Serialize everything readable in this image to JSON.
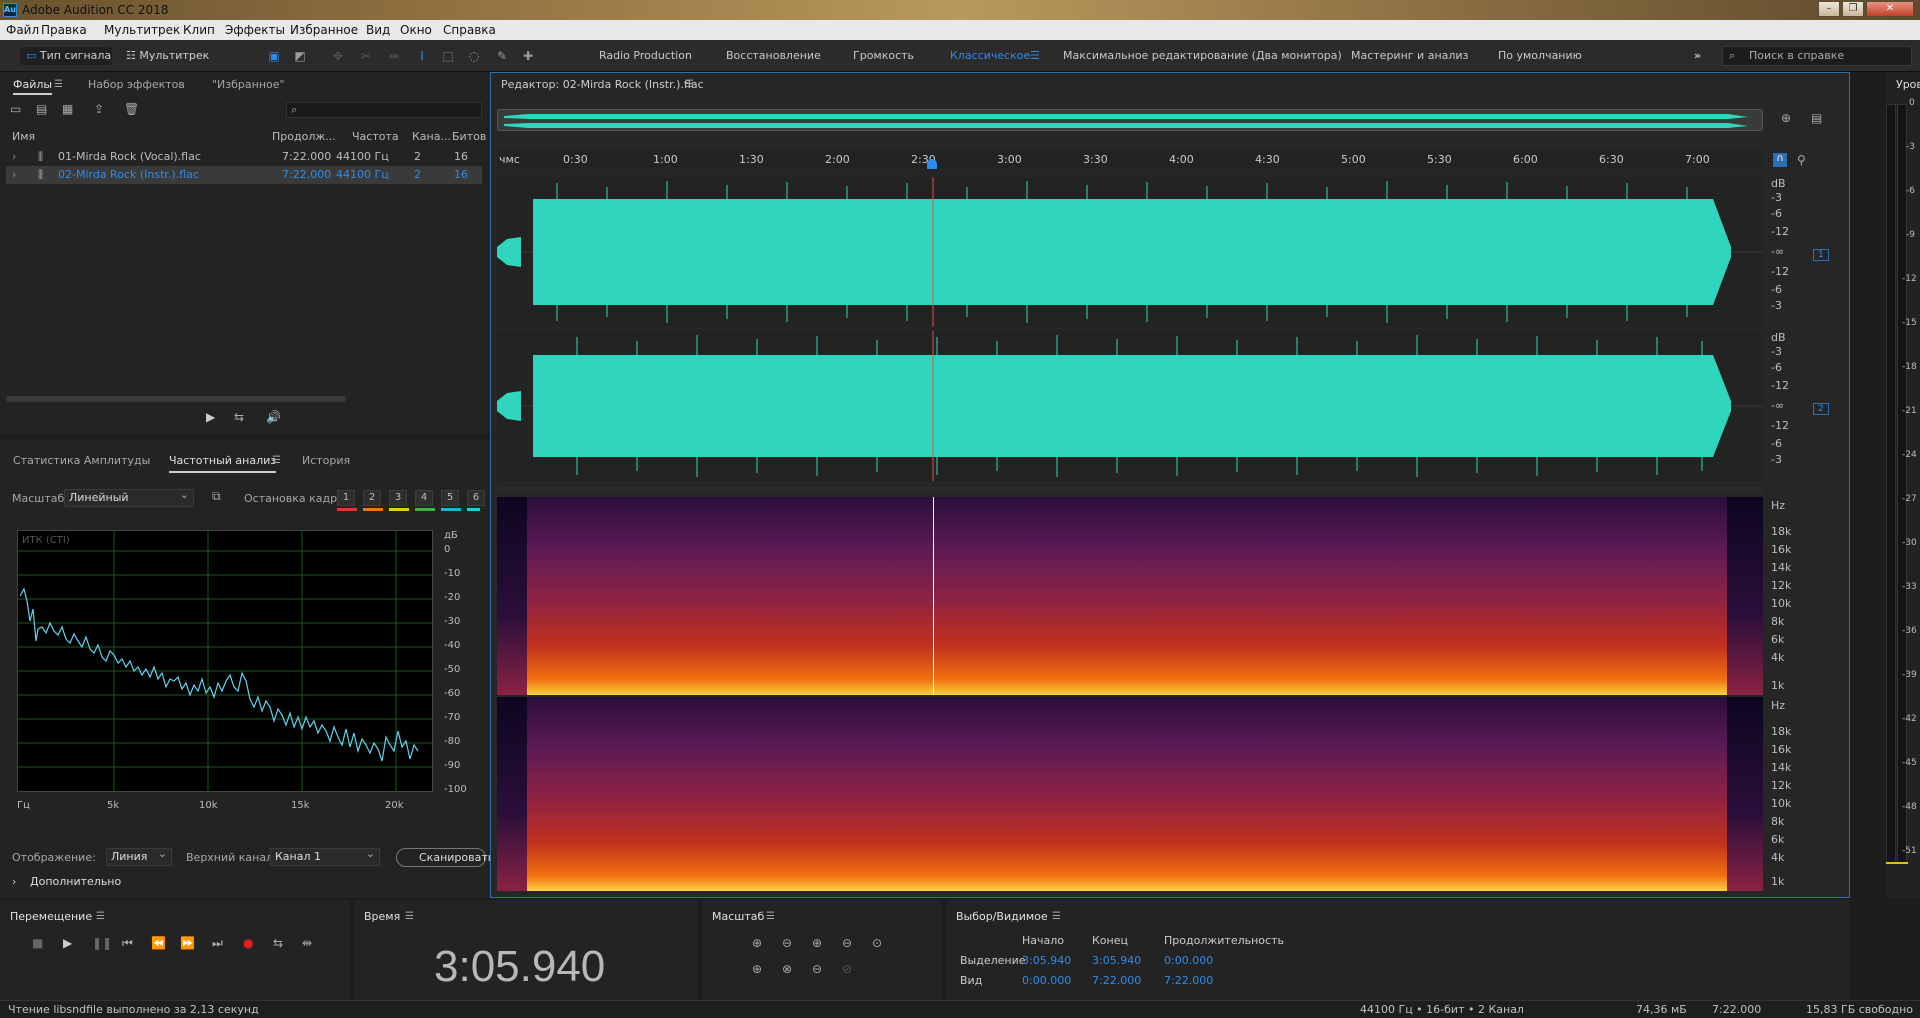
{
  "titlebar": {
    "title": "Adobe Audition CC 2018",
    "app_icon": "Au"
  },
  "menu": [
    "Файл",
    "Правка",
    "Мультитрек",
    "Клип",
    "Эффекты",
    "Избранное",
    "Вид",
    "Окно",
    "Справка"
  ],
  "toolbar": {
    "waveform": "Тип сигнала",
    "multitrack": "Мультитрек",
    "workspaces": [
      "Radio Production",
      "Восстановление",
      "Громкость",
      "Классическое",
      "Максимальное редактирование (Два монитора)",
      "Мастеринг и анализ",
      "По умолчанию"
    ],
    "active_workspace": "Классическое",
    "search_placeholder": "Поиск в справке"
  },
  "files_panel": {
    "tabs": [
      "Файлы",
      "Набор эффектов",
      "\"Избранное\""
    ],
    "columns": [
      "Имя",
      "Продолж...",
      "Частота",
      "Кана...",
      "Битов"
    ],
    "rows": [
      {
        "name": "01-Mirda Rock (Vocal).flac",
        "duration": "7:22.000",
        "rate": "44100 Гц",
        "channels": "2",
        "bits": "16",
        "selected": false
      },
      {
        "name": "02-Mirda Rock (Instr.).flac",
        "duration": "7:22.000",
        "rate": "44100 Гц",
        "channels": "2",
        "bits": "16",
        "selected": true
      }
    ]
  },
  "analysis_panel": {
    "tabs": [
      "Статистика Амплитуды",
      "Частотный анализ",
      "История"
    ],
    "scale_label": "Масштаб:",
    "scale_value": "Линейный",
    "freeze_label": "Остановка кадра:",
    "freeze_slots": [
      "1",
      "2",
      "3",
      "4",
      "5",
      "6"
    ],
    "slot_colors": [
      "#e03a2a",
      "#e07a1a",
      "#e0d01a",
      "#3ab43a",
      "#1ab4d0",
      "#1ad0e0"
    ],
    "plot_label": "ИТК (СТI)",
    "db_ticks": [
      "дБ",
      "0",
      "-10",
      "-20",
      "-30",
      "-40",
      "-50",
      "-60",
      "-70",
      "-80",
      "-90",
      "-100"
    ],
    "freq_ticks": [
      "Гц",
      "5k",
      "10k",
      "15k",
      "20k"
    ],
    "display_label": "Отображение:",
    "display_value": "Линия",
    "channel_label": "Верхний канал:",
    "channel_value": "Канал 1",
    "scan_button": "Сканировать",
    "advanced": "Дополнительно"
  },
  "editor": {
    "title": "Редактор: 02-Mirda Rock (Instr.).flac",
    "ruler": [
      "чмс",
      "0:30",
      "1:00",
      "1:30",
      "2:00",
      "2:30",
      "3:00",
      "3:30",
      "4:00",
      "4:30",
      "5:00",
      "5:30",
      "6:00",
      "6:30",
      "7:00"
    ],
    "db_scale": [
      "dB",
      "-3",
      "-6",
      "-12",
      "-∞",
      "-12",
      "-6",
      "-3"
    ],
    "channel_badges": [
      "1",
      "2"
    ],
    "hz_scale": [
      "Hz",
      "18k",
      "16k",
      "14k",
      "12k",
      "10k",
      "8k",
      "6k",
      "4k",
      "1k"
    ],
    "wave_color": "#2fd6bd"
  },
  "levels": {
    "title": "Уровни",
    "ticks": [
      "0",
      "-3",
      "-6",
      "-9",
      "-12",
      "-15",
      "-18",
      "-21",
      "-24",
      "-27",
      "-30",
      "-33",
      "-36",
      "-39",
      "-42",
      "-45",
      "-48",
      "-51"
    ]
  },
  "transport": {
    "title": "Перемещение"
  },
  "time": {
    "title": "Время",
    "value": "3:05.940"
  },
  "zoom": {
    "title": "Масштаб"
  },
  "selection": {
    "title": "Выбор/Видимое",
    "col_start": "Начало",
    "col_end": "Конец",
    "col_dur": "Продолжительность",
    "sel_label": "Выделение",
    "sel_start": "3:05.940",
    "sel_end": "3:05.940",
    "sel_dur": "0:00.000",
    "view_label": "Вид",
    "view_start": "0:00.000",
    "view_end": "7:22.000",
    "view_dur": "7:22.000"
  },
  "status": {
    "left": "Чтение libsndfile выполнено за 2,13 секунд",
    "format": "44100 Гц • 16-бит • 2 Канал",
    "size": "74,36 мБ",
    "duration": "7:22.000",
    "free": "15,83 ГБ свободно"
  }
}
